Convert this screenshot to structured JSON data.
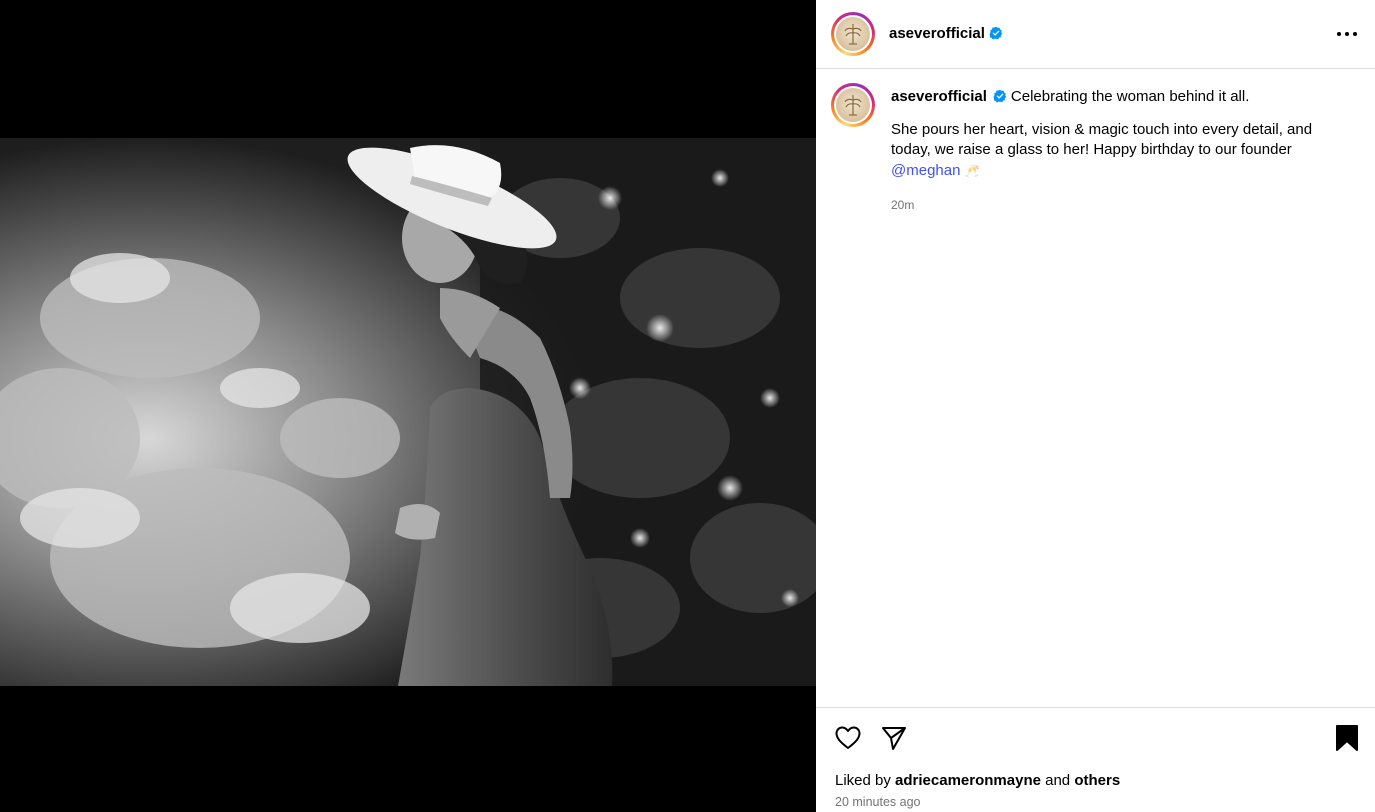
{
  "post": {
    "username": "aseverofficial",
    "verified": true,
    "avatar_icon": "brand-logo-avatar",
    "media_description_icon": "photo-woman-in-hat-garden",
    "caption": {
      "line1": "Celebrating the woman behind it all.",
      "body": "She pours her heart, vision & magic touch into every detail, and today, we raise a glass to her! Happy birthday to our founder",
      "mention": "@meghan",
      "emoji": "🥂"
    },
    "caption_time": "20m"
  },
  "actions": {
    "like_icon": "heart-icon",
    "share_icon": "paper-plane-icon",
    "save_icon": "bookmark-icon",
    "more_icon": "more-options-icon"
  },
  "likes": {
    "prefix": "Liked by",
    "user": "adriecameronmayne",
    "joiner": "and",
    "others": "others"
  },
  "timestamp": "20 minutes ago",
  "colors": {
    "mention": "#4150f7",
    "verified": "#0095f6",
    "muted": "#737373",
    "divider": "#dbdbdb"
  }
}
